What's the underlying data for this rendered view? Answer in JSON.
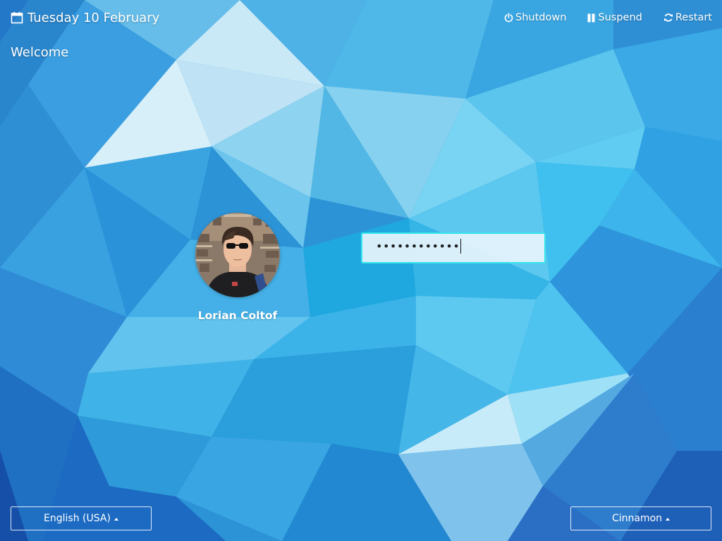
{
  "header": {
    "date": "Tuesday 10 February",
    "date_icon": "calendar-icon",
    "welcome": "Welcome"
  },
  "power": {
    "shutdown_label": "Shutdown",
    "shutdown_icon": "power-icon",
    "suspend_label": "Suspend",
    "suspend_icon": "pause-icon",
    "restart_label": "Restart",
    "restart_icon": "refresh-icon"
  },
  "user": {
    "name": "Lorian Coltof",
    "avatar_icon": "user-avatar-photo"
  },
  "password": {
    "masked_value": "••••••••••••",
    "focus_color": "#36e6ec"
  },
  "footer": {
    "language": "English (USA)",
    "session": "Cinnamon"
  },
  "colors": {
    "background_base": "#2d9fdc",
    "text": "#ffffff"
  }
}
